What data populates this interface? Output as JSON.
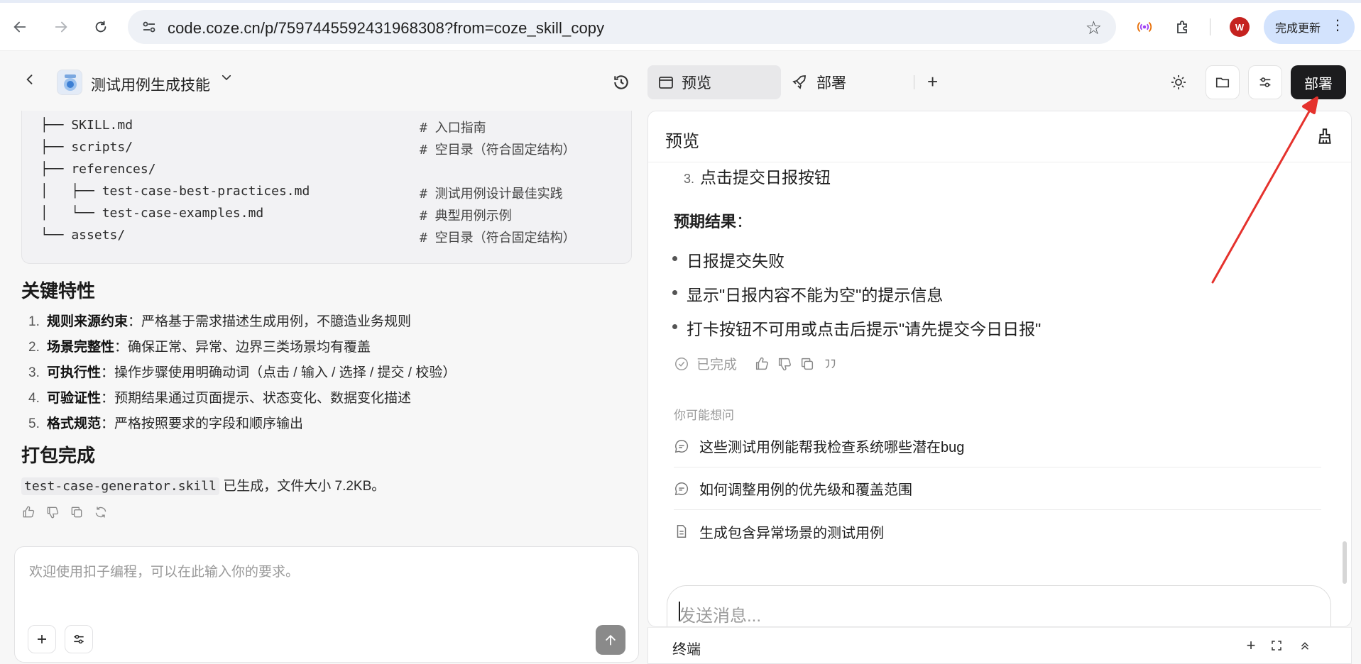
{
  "browser": {
    "url": "code.coze.cn/p/7597445592431968308?from=coze_skill_copy",
    "profile_initial": "W",
    "update_label": "完成更新"
  },
  "header": {
    "project_title": "测试用例生成技能",
    "tabs": [
      {
        "label": "预览"
      },
      {
        "label": "部署"
      }
    ],
    "deploy_label": "部署"
  },
  "left": {
    "tree": [
      {
        "path": "├── SKILL.md",
        "comment": "# 入口指南"
      },
      {
        "path": "├── scripts/",
        "comment": "# 空目录（符合固定结构）"
      },
      {
        "path": "├── references/",
        "comment": ""
      },
      {
        "path": "│   ├── test-case-best-practices.md",
        "comment": "# 测试用例设计最佳实践"
      },
      {
        "path": "│   └── test-case-examples.md",
        "comment": "# 典型用例示例"
      },
      {
        "path": "└── assets/",
        "comment": "# 空目录（符合固定结构）"
      }
    ],
    "features_heading": "关键特性",
    "features": [
      {
        "num": "1.",
        "title": "规则来源约束",
        "desc": "：严格基于需求描述生成用例，不臆造业务规则"
      },
      {
        "num": "2.",
        "title": "场景完整性",
        "desc": "：确保正常、异常、边界三类场景均有覆盖"
      },
      {
        "num": "3.",
        "title": "可执行性",
        "desc": "：操作步骤使用明确动词（点击 / 输入 / 选择 / 提交 / 校验）"
      },
      {
        "num": "4.",
        "title": "可验证性",
        "desc": "：预期结果通过页面提示、状态变化、数据变化描述"
      },
      {
        "num": "5.",
        "title": "格式规范",
        "desc": "：严格按照要求的字段和顺序输出"
      }
    ],
    "pack_heading": "打包完成",
    "pack_file": "test-case-generator.skill",
    "pack_text": " 已生成，文件大小 7.2KB。",
    "input_placeholder": "欢迎使用扣子编程，可以在此输入你的要求。"
  },
  "preview": {
    "title": "预览",
    "step3_num": "3.",
    "step3_text": "点击提交日报按钮",
    "expect_label": "预期结果",
    "expect_colon": "：",
    "bullets": [
      "日报提交失败",
      "显示\"日报内容不能为空\"的提示信息",
      "打卡按钮不可用或点击后提示\"请先提交今日日报\""
    ],
    "done_label": "已完成",
    "suggest_title": "你可能想问",
    "suggestions": [
      "这些测试用例能帮我检查系统哪些潜在bug",
      "如何调整用例的优先级和覆盖范围",
      "生成包含异常场景的测试用例"
    ],
    "message_placeholder": "发送消息...",
    "terminal_label": "终端"
  },
  "colors": {
    "accent_dark": "#1c1c1e",
    "annotation_red": "#e5322d",
    "profile_red": "#c5221f"
  }
}
